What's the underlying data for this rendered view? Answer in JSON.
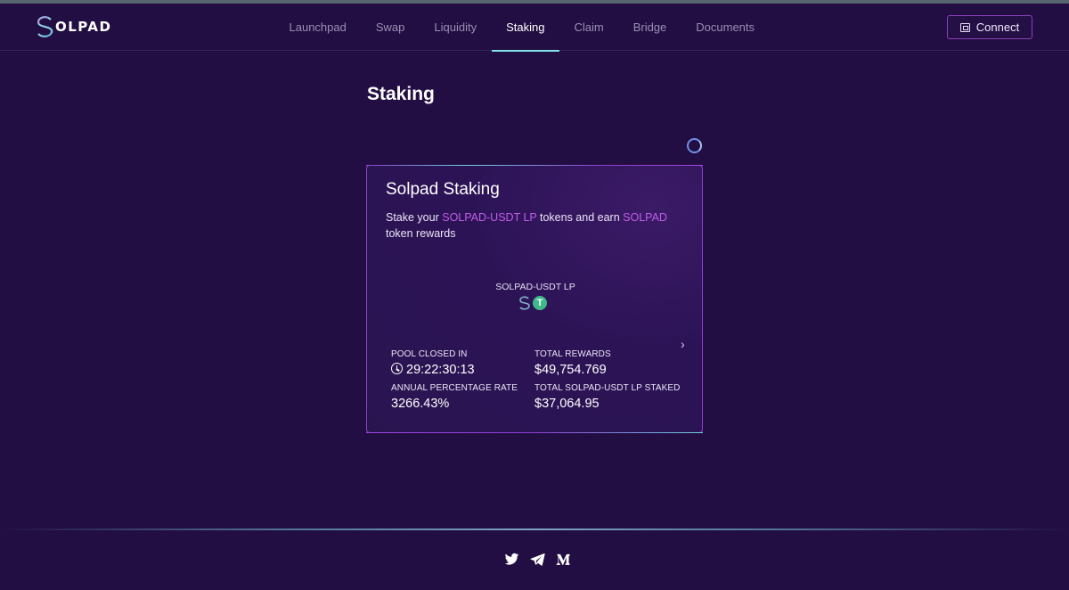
{
  "app": {
    "brand": "OLPAD"
  },
  "nav": {
    "items": [
      {
        "label": "Launchpad",
        "active": false
      },
      {
        "label": "Swap",
        "active": false
      },
      {
        "label": "Liquidity",
        "active": false
      },
      {
        "label": "Staking",
        "active": true
      },
      {
        "label": "Claim",
        "active": false
      },
      {
        "label": "Bridge",
        "active": false
      },
      {
        "label": "Documents",
        "active": false
      }
    ],
    "connect_label": "Connect"
  },
  "page": {
    "title": "Staking"
  },
  "card": {
    "title": "Solpad Staking",
    "desc_prefix": "Stake your ",
    "desc_token": "SOLPAD-USDT LP",
    "desc_middle": " tokens and earn ",
    "desc_reward": "SOLPAD",
    "desc_suffix": " token rewards",
    "pair_label": "SOLPAD-USDT LP",
    "tether_glyph": "T",
    "next_glyph": "›",
    "stats": {
      "pool_closed_label": "POOL CLOSED IN",
      "pool_closed_value": "29:22:30:13",
      "total_rewards_label": "TOTAL REWARDS",
      "total_rewards_value": "$49,754.769",
      "apr_label": "ANNUAL PERCENTAGE RATE",
      "apr_value": "3266.43%",
      "total_staked_label": "TOTAL SOLPAD-USDT LP STAKED",
      "total_staked_value": "$37,064.95"
    }
  },
  "colors": {
    "accent": "#c15ee8",
    "active_underline": "#7fe3ea",
    "background": "#220e42"
  },
  "footer": {
    "socials": [
      "twitter-icon",
      "telegram-icon",
      "medium-icon"
    ]
  }
}
